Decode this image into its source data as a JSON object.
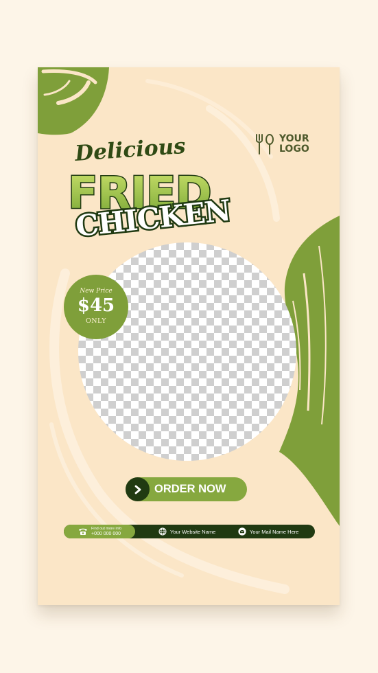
{
  "flyer": {
    "logo_text": "YOUR LOGO",
    "logo_icon": "fork-spoon-icon",
    "headline_script": "Delicious",
    "headline_main": "FRIED",
    "headline_sub": "CHICKEN",
    "photo_placeholder": "transparent-checkerboard",
    "badge": {
      "top": "New Price",
      "price": "$45",
      "bottom": "ONLY"
    },
    "cta_label": "ORDER NOW",
    "cta_icon": "chevron-right-icon",
    "footer": {
      "phone_caption": "Find out more info",
      "phone_number": "+000 000 000",
      "phone_icon": "phone-icon",
      "website": "Your Website Name",
      "website_icon": "globe-icon",
      "mail": "Your Mail Name Here",
      "mail_icon": "mail-icon"
    }
  },
  "colors": {
    "page_background": "#fdf5e8",
    "card_background": "#fbe6c7",
    "brand_green": "#86a83f",
    "dark_green": "#203a12",
    "light_green_gradient": "#b9d85a"
  }
}
